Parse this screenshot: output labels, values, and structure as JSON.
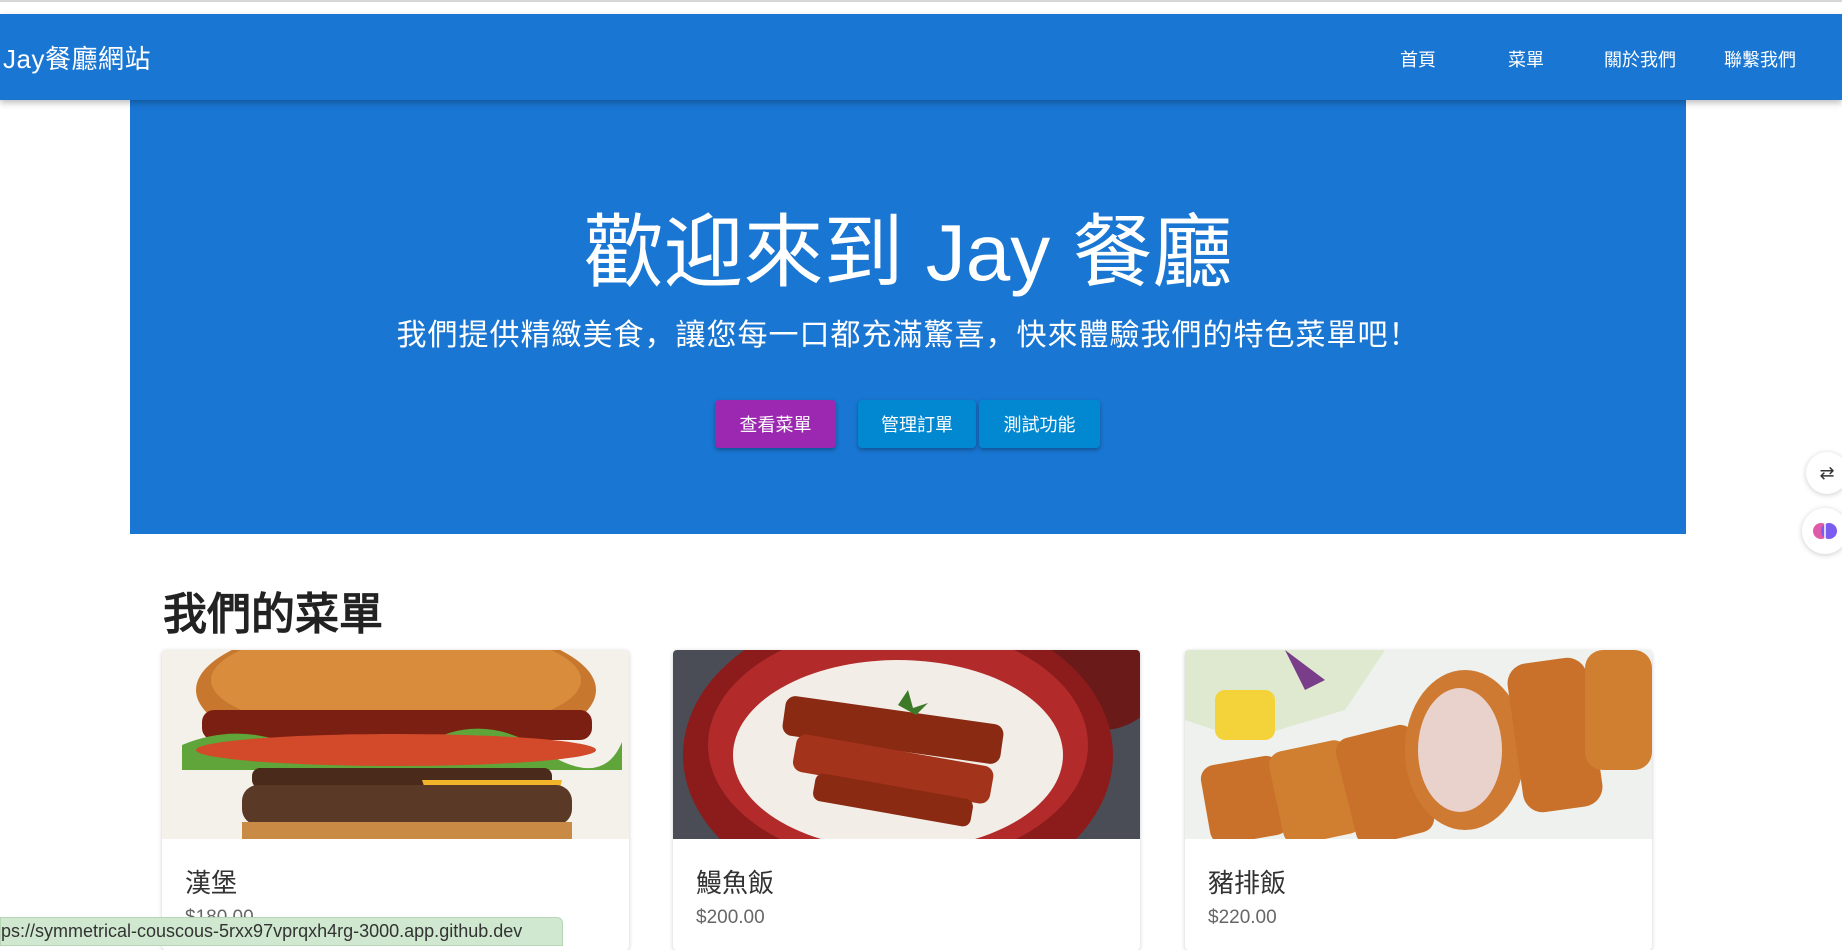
{
  "navbar": {
    "brand": "Jay餐廳網站",
    "links": [
      "首頁",
      "菜單",
      "關於我們",
      "聯繫我們"
    ]
  },
  "hero": {
    "title": "歡迎來到 Jay 餐廳",
    "subtitle": "我們提供精緻美食，讓您每一口都充滿驚喜，快來體驗我們的特色菜單吧！",
    "buttons": {
      "view_menu": "查看菜單",
      "manage_orders": "管理訂單",
      "test": "測試功能"
    }
  },
  "menu": {
    "title": "我們的菜單",
    "items": [
      {
        "name": "漢堡",
        "price": "$180.00"
      },
      {
        "name": "鰻魚飯",
        "price": "$200.00"
      },
      {
        "name": "豬排飯",
        "price": "$220.00"
      }
    ]
  },
  "status_url": "ps://symmetrical-couscous-5rxx97vprqxh4rg-3000.app.github.dev",
  "colors": {
    "primary": "#1976d2",
    "purple": "#9c27b0",
    "info": "#0288d1"
  },
  "side_tools": [
    "translate-icon",
    "brain-icon"
  ]
}
